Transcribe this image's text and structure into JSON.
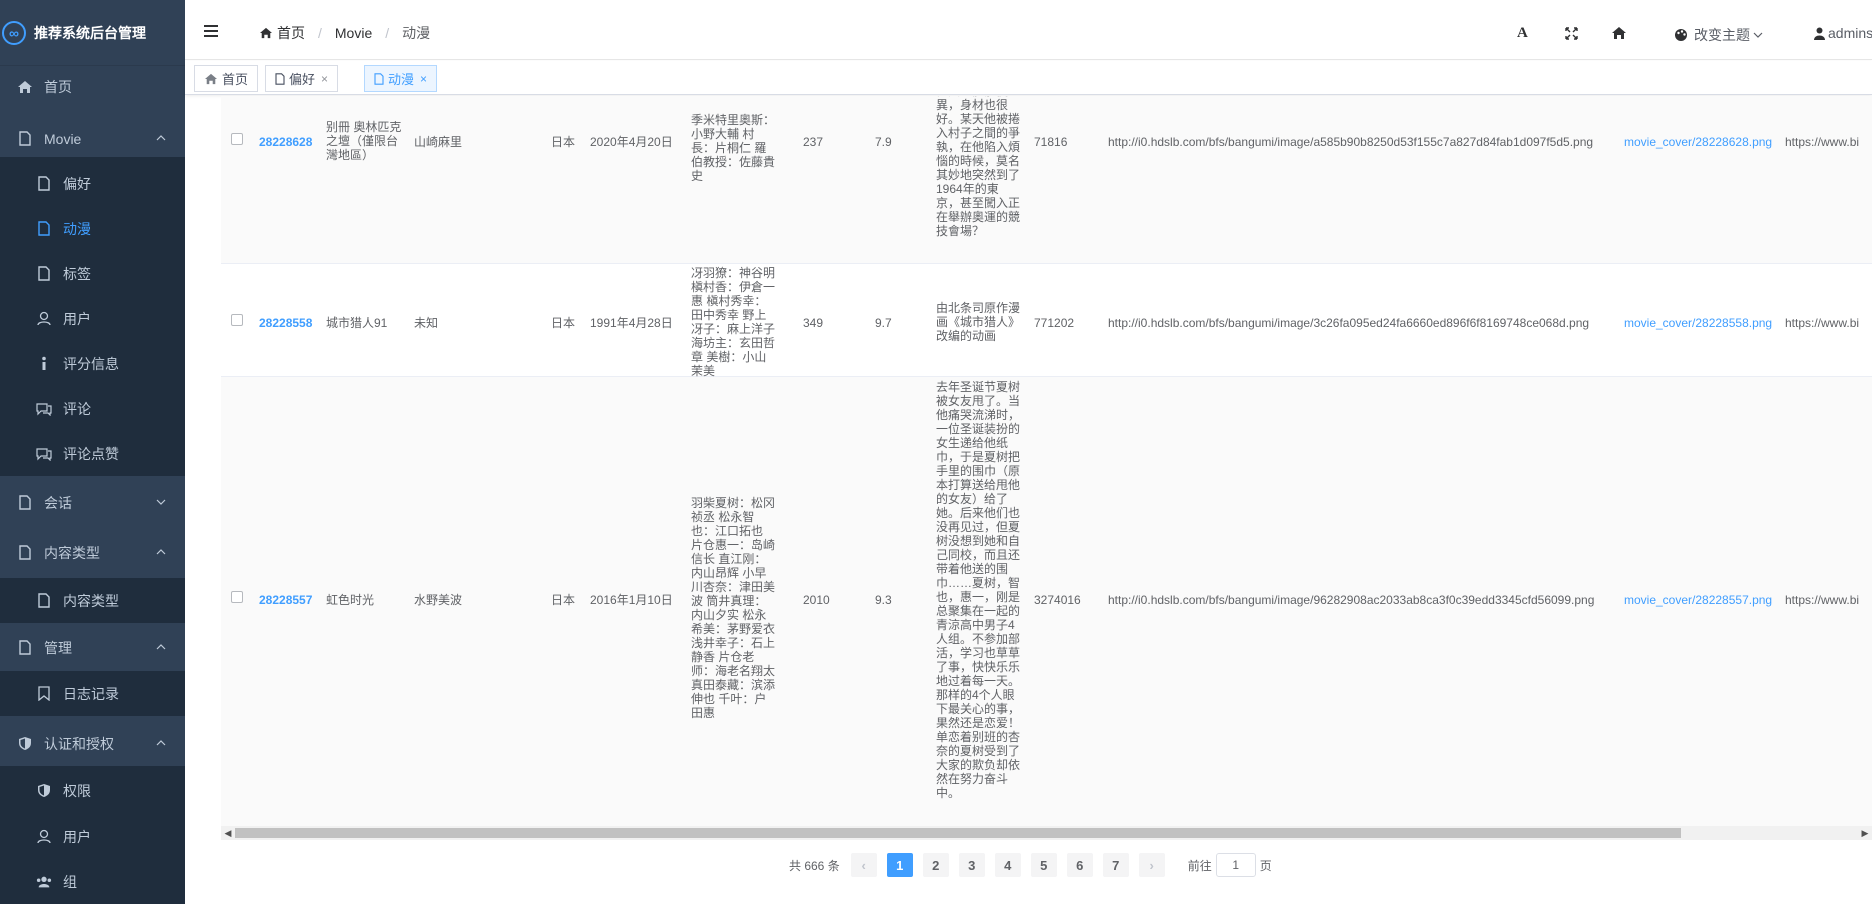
{
  "app": {
    "title": "推荐系统后台管理",
    "logo_glyph": "∞"
  },
  "sidebar": {
    "items": [
      {
        "label": "首页",
        "icon": "home-icon"
      },
      {
        "label": "Movie",
        "icon": "document-icon"
      },
      {
        "label": "偏好",
        "icon": "document-icon"
      },
      {
        "label": "动漫",
        "icon": "document-icon"
      },
      {
        "label": "标签",
        "icon": "document-icon"
      },
      {
        "label": "用户",
        "icon": "user-icon"
      },
      {
        "label": "评分信息",
        "icon": "info-icon"
      },
      {
        "label": "评论",
        "icon": "chat-icon"
      },
      {
        "label": "评论点赞",
        "icon": "chat-icon"
      },
      {
        "label": "会话",
        "icon": "document-icon"
      },
      {
        "label": "内容类型",
        "icon": "document-icon"
      },
      {
        "label": "内容类型",
        "icon": "document-icon"
      },
      {
        "label": "管理",
        "icon": "document-icon"
      },
      {
        "label": "日志记录",
        "icon": "bookmark-icon"
      },
      {
        "label": "认证和授权",
        "icon": "shield-icon"
      },
      {
        "label": "权限",
        "icon": "shield-icon"
      },
      {
        "label": "用户",
        "icon": "user-icon"
      },
      {
        "label": "组",
        "icon": "group-icon"
      }
    ]
  },
  "navbar": {
    "breadcrumb": [
      "首页",
      "Movie",
      "动漫"
    ],
    "font_icon": "A",
    "theme_label": "改变主题",
    "user_label": "admins"
  },
  "tags": [
    {
      "label": "首页"
    },
    {
      "label": "偏好",
      "close": "×"
    },
    {
      "label": "动漫",
      "close": "×"
    }
  ],
  "table": {
    "rows": [
      {
        "id": "28228628",
        "name": "别冊 奧林匹克之壇（僅限台灣地區）",
        "director": "山崎麻里",
        "country": "日本",
        "date": "2020年4月20日",
        "cast": "季米特里奧斯：小野大輔 村長：片桐仁 羅伯教授：佐藤貴史",
        "count": "237",
        "score": "7.9",
        "summary": "他天生體能優異，身材也很好。某天他被捲入村子之間的爭執，在他陷入煩惱的時候，莫名其妙地突然到了1964年的東京，甚至闖入正在舉辦奧運的競技會場？",
        "views": "71816",
        "image_url": "http://i0.hdslb.com/bfs/bangumi/image/a585b90b8250d53f155c7a827d84fab1d097f5d5.png",
        "cover": "movie_cover/28228628.png",
        "link": "https://www.bi"
      },
      {
        "id": "28228558",
        "name": "城市猎人91",
        "director": "未知",
        "country": "日本",
        "date": "1991年4月28日",
        "cast": "冴羽獠：神谷明 槇村香：伊倉一惠 槇村秀幸：田中秀幸 野上冴子：麻上洋子 海坊主：玄田哲章 美樹：小山茉美",
        "count": "349",
        "score": "9.7",
        "summary": "由北条司原作漫画《城市猎人》改编的动画",
        "views": "771202",
        "image_url": "http://i0.hdslb.com/bfs/bangumi/image/3c26fa095ed24fa6660ed896f6f8169748ce068d.png",
        "cover": "movie_cover/28228558.png",
        "link": "https://www.bi"
      },
      {
        "id": "28228557",
        "name": "虹色时光",
        "director": "水野美波",
        "country": "日本",
        "date": "2016年1月10日",
        "cast": "羽柴夏树：松冈祯丞 松永智也：江口拓也 片仓惠一：岛崎信长 直江刚：内山昂辉 小早川杏奈：津田美波 筒井真理：内山夕实 松永希美：茅野爱衣 浅井幸子：石上静香 片仓老师：海老名翔太 真田泰藏：滨添伸也 千叶：户田惠",
        "count": "2010",
        "score": "9.3",
        "summary": "去年圣诞节夏树被女友甩了。当他痛哭流涕时，一位圣诞装扮的女生递给他纸巾，于是夏树把手里的围巾（原本打算送给甩他的女友）给了她。后来他们也没再见过，但夏树没想到她和自己同校，而且还带着他送的围巾……夏树，智也，惠一，刚是总聚集在一起的青涼高中男子4人组。不参加部活，学习也草草了事，快快乐乐地过着每一天。那样的4个人眼下最关心的事，果然还是恋爱！单恋着别班的杏奈的夏树受到了大家的欺负却依然在努力奋斗中。",
        "views": "3274016",
        "image_url": "http://i0.hdslb.com/bfs/bangumi/image/96282908ac2033ab8ca3f0c39edd3345cfd56099.png",
        "cover": "movie_cover/28228557.png",
        "link": "https://www.bi"
      }
    ]
  },
  "pagination": {
    "total_text": "共 666 条",
    "prev": "‹",
    "next": "›",
    "pages": [
      "1",
      "2",
      "3",
      "4",
      "5",
      "6",
      "7"
    ],
    "current": "1",
    "goto_prefix": "前往",
    "goto_value": "1",
    "goto_suffix": "页"
  },
  "colors": {
    "sidebar_bg": "#304156",
    "submenu_bg": "#1f2d3d",
    "accent": "#409eff",
    "menu_text": "#bfcbd9"
  }
}
